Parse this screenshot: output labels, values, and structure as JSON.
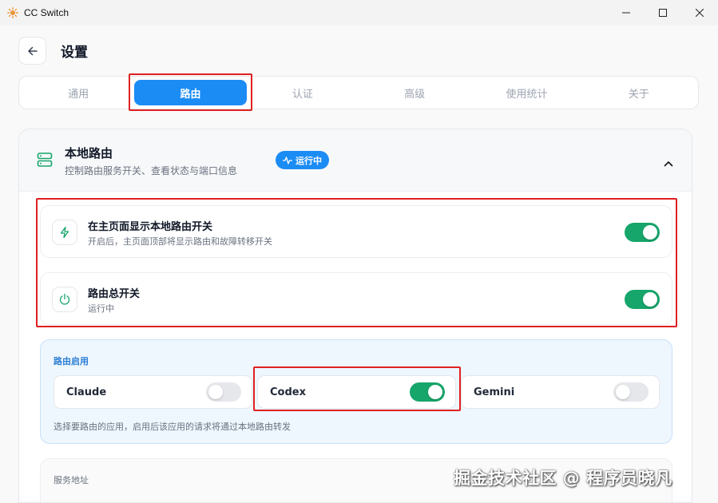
{
  "window": {
    "title": "CC Switch",
    "controls": {
      "minimize": "minimize-icon",
      "maximize": "maximize-icon",
      "close": "close-icon"
    }
  },
  "header": {
    "title": "设置",
    "back_icon": "arrow-left-icon"
  },
  "tabs": [
    {
      "label": "通用",
      "active": false
    },
    {
      "label": "路由",
      "active": true
    },
    {
      "label": "认证",
      "active": false
    },
    {
      "label": "高级",
      "active": false
    },
    {
      "label": "使用统计",
      "active": false
    },
    {
      "label": "关于",
      "active": false
    }
  ],
  "local_routing": {
    "title": "本地路由",
    "subtitle": "控制路由服务开关、查看状态与端口信息",
    "status_badge": "运行中",
    "icon": "server-icon",
    "collapse_icon": "chevron-up-icon"
  },
  "settings": [
    {
      "title": "在主页面显示本地路由开关",
      "description": "开启后，主页面顶部将显示路由和故障转移开关",
      "icon": "lightning-icon",
      "enabled": true
    },
    {
      "title": "路由总开关",
      "description": "运行中",
      "icon": "power-icon",
      "enabled": true
    }
  ],
  "routing_apps": {
    "label": "路由启用",
    "apps": [
      {
        "name": "Claude",
        "enabled": false
      },
      {
        "name": "Codex",
        "enabled": true
      },
      {
        "name": "Gemini",
        "enabled": false
      }
    ],
    "hint": "选择要路由的应用，启用后该应用的请求将通过本地路由转发"
  },
  "service_address": {
    "label": "服务地址"
  },
  "watermark": "掘金技术社区 @ 程序员晓凡",
  "colors": {
    "accent_blue": "#1c8cf5",
    "toggle_on": "#16a56a",
    "highlight_red": "#e02020",
    "icon_green": "#16a56a"
  }
}
